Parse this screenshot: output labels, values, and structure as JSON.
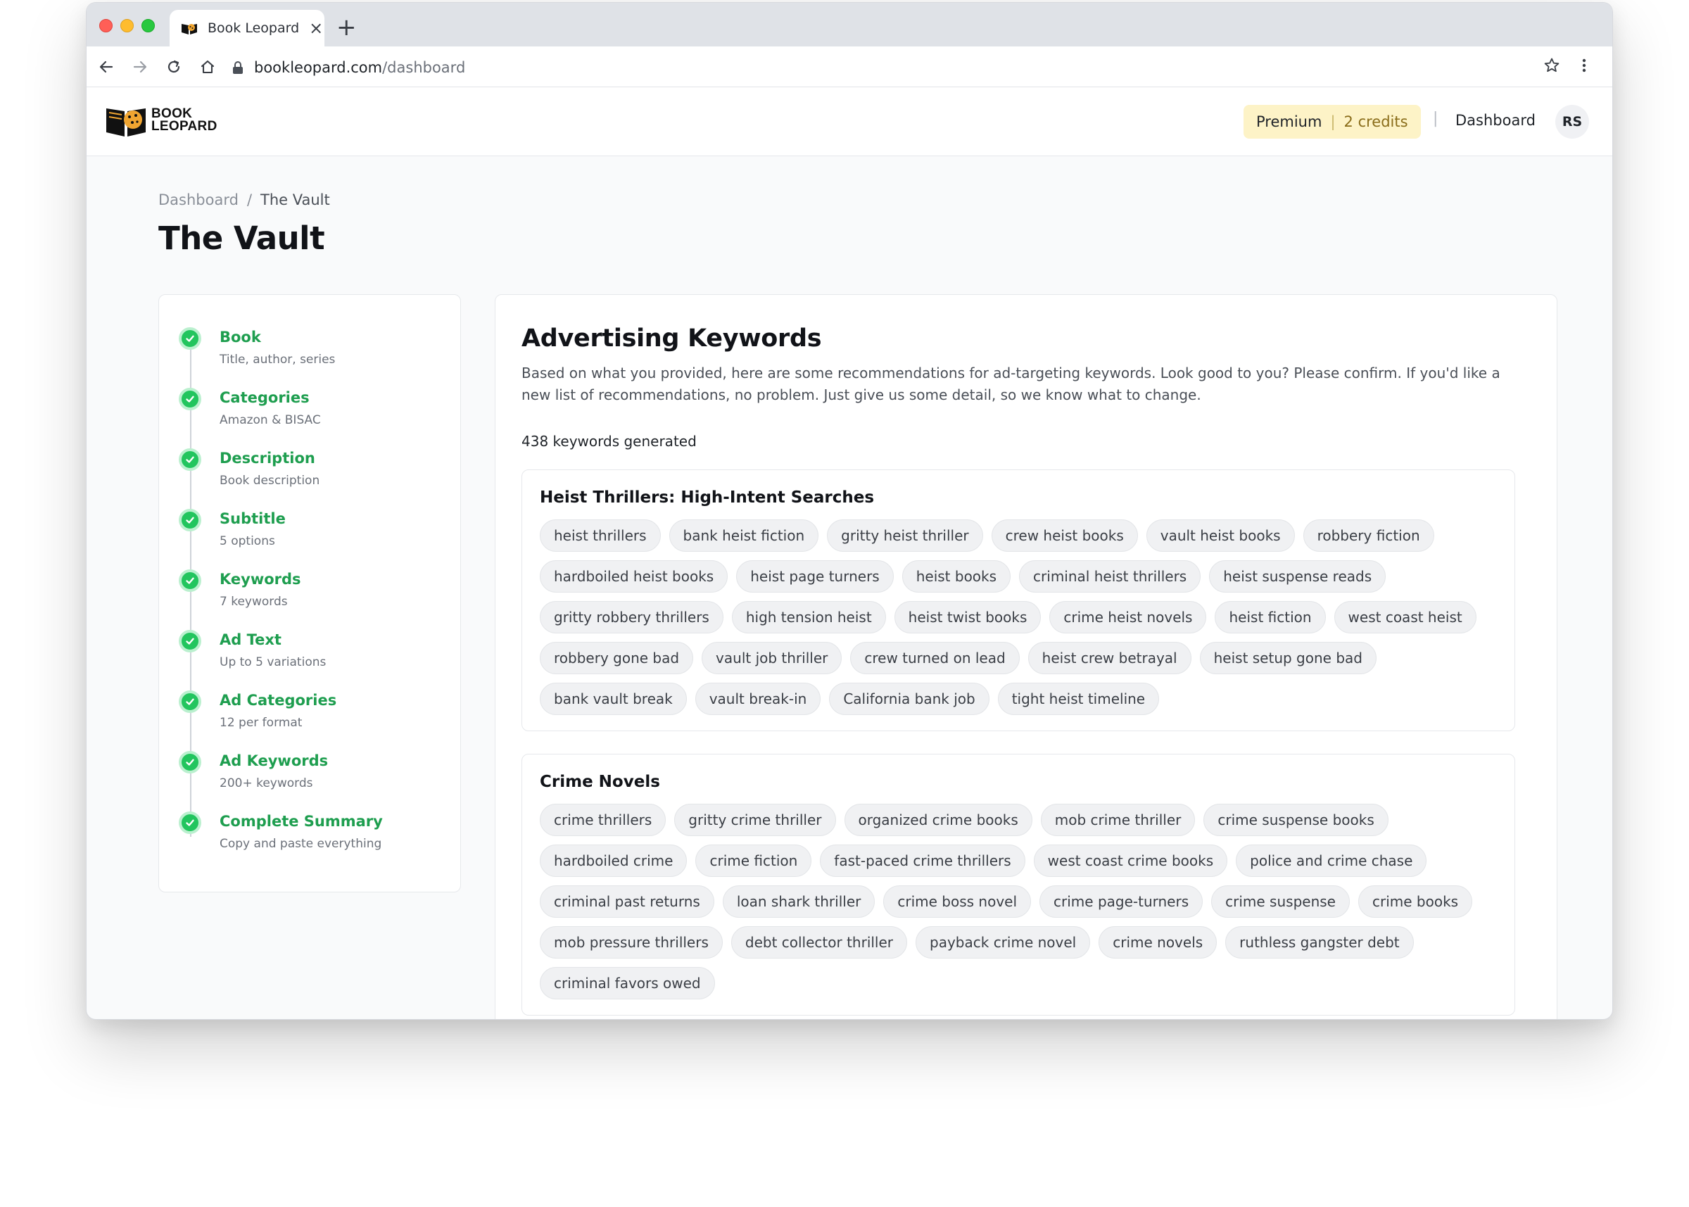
{
  "browser": {
    "tab_title": "Book Leopard",
    "url_domain": "bookleopard.com",
    "url_path": "/dashboard"
  },
  "header": {
    "logo_line1": "BOOK",
    "logo_line2": "LEOPARD",
    "plan": "Premium",
    "credits": "2 credits",
    "divider": "|",
    "nav_dashboard": "Dashboard",
    "avatar_initials": "RS"
  },
  "breadcrumb": {
    "parent": "Dashboard",
    "separator": "/",
    "current": "The Vault"
  },
  "page_title": "The Vault",
  "steps": [
    {
      "title": "Book",
      "subtitle": "Title, author, series"
    },
    {
      "title": "Categories",
      "subtitle": "Amazon & BISAC"
    },
    {
      "title": "Description",
      "subtitle": "Book description"
    },
    {
      "title": "Subtitle",
      "subtitle": "5 options"
    },
    {
      "title": "Keywords",
      "subtitle": "7 keywords"
    },
    {
      "title": "Ad Text",
      "subtitle": "Up to 5 variations"
    },
    {
      "title": "Ad Categories",
      "subtitle": "12 per format"
    },
    {
      "title": "Ad Keywords",
      "subtitle": "200+ keywords"
    },
    {
      "title": "Complete Summary",
      "subtitle": "Copy and paste everything"
    }
  ],
  "main": {
    "title": "Advertising Keywords",
    "description": "Based on what you provided, here are some recommendations for ad-targeting keywords. Look good to you? Please confirm. If you'd like a new list of recommendations, no problem. Just give us some detail, so we know what to change.",
    "keyword_count": "438 keywords generated",
    "groups": [
      {
        "title": "Heist Thrillers: High-Intent Searches",
        "keywords": [
          "heist thrillers",
          "bank heist fiction",
          "gritty heist thriller",
          "crew heist books",
          "vault heist books",
          "robbery fiction",
          "hardboiled heist books",
          "heist page turners",
          "heist books",
          "criminal heist thrillers",
          "heist suspense reads",
          "gritty robbery thrillers",
          "high tension heist",
          "heist twist books",
          "crime heist novels",
          "heist fiction",
          "west coast heist",
          "robbery gone bad",
          "vault job thriller",
          "crew turned on lead",
          "heist crew betrayal",
          "heist setup gone bad",
          "bank vault break",
          "vault break-in",
          "California bank job",
          "tight heist timeline"
        ]
      },
      {
        "title": "Crime Novels",
        "keywords": [
          "crime thrillers",
          "gritty crime thriller",
          "organized crime books",
          "mob crime thriller",
          "crime suspense books",
          "hardboiled crime",
          "crime fiction",
          "fast-paced crime thrillers",
          "west coast crime books",
          "police and crime chase",
          "criminal past returns",
          "loan shark thriller",
          "crime boss novel",
          "crime page-turners",
          "crime suspense",
          "crime books",
          "mob pressure thrillers",
          "debt collector thriller",
          "payback crime novel",
          "crime novels",
          "ruthless gangster debt",
          "criminal favors owed"
        ]
      }
    ]
  }
}
